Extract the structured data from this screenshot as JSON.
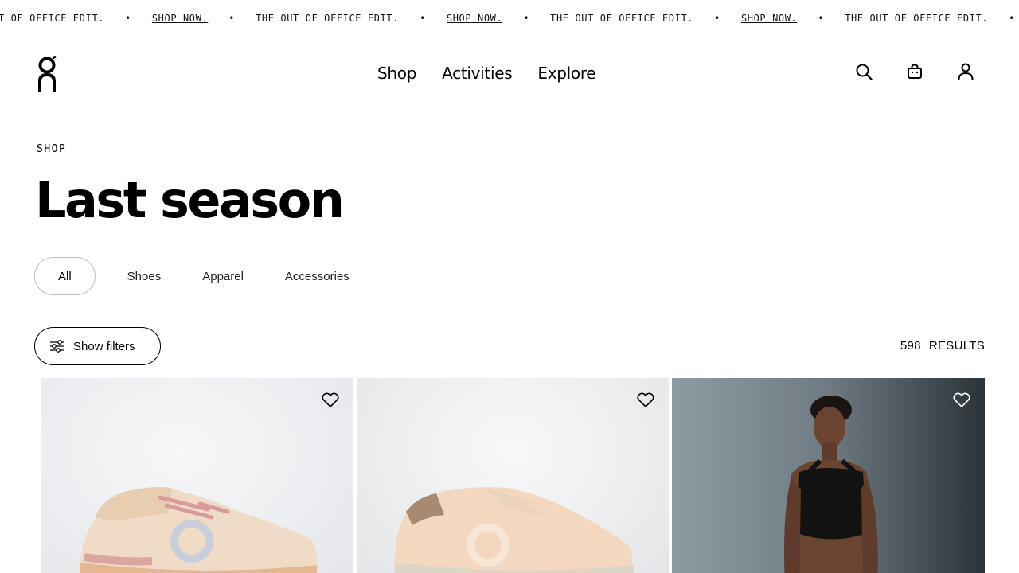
{
  "marquee": {
    "items": [
      {
        "type": "text",
        "text": "T OF OFFICE EDIT."
      },
      {
        "type": "dot",
        "text": "•"
      },
      {
        "type": "link",
        "text": "SHOP NOW."
      },
      {
        "type": "dot",
        "text": "•"
      },
      {
        "type": "text",
        "text": "THE OUT OF OFFICE EDIT."
      },
      {
        "type": "dot",
        "text": "•"
      },
      {
        "type": "link",
        "text": "SHOP NOW."
      },
      {
        "type": "dot",
        "text": "•"
      },
      {
        "type": "text",
        "text": "THE OUT OF OFFICE EDIT."
      },
      {
        "type": "dot",
        "text": "•"
      },
      {
        "type": "link",
        "text": "SHOP NOW."
      },
      {
        "type": "dot",
        "text": "•"
      },
      {
        "type": "text",
        "text": "THE OUT OF OFFICE EDIT."
      },
      {
        "type": "dot",
        "text": "•"
      }
    ]
  },
  "header": {
    "logo_icon": "on-logo-icon",
    "nav": [
      "Shop",
      "Activities",
      "Explore"
    ],
    "icons": [
      "search-icon",
      "bag-icon",
      "account-icon"
    ]
  },
  "page": {
    "eyebrow": "SHOP",
    "title": "Last season"
  },
  "tabs": {
    "active": "All",
    "items": [
      "All",
      "Shoes",
      "Apparel",
      "Accessories"
    ]
  },
  "filters": {
    "button_label": "Show filters",
    "icon": "sliders-icon",
    "results_count": "598",
    "results_label": "RESULTS"
  },
  "products": [
    {
      "image": "shoe-cream-pink",
      "wishlist_icon": "heart-icon"
    },
    {
      "image": "shoe-peach",
      "wishlist_icon": "heart-icon"
    },
    {
      "image": "woman-black-sports-bra",
      "wishlist_icon": "heart-icon"
    }
  ],
  "colors": {
    "text": "#000000",
    "tab_border": "#bdbdbd",
    "card_bg": "#eceef1"
  }
}
